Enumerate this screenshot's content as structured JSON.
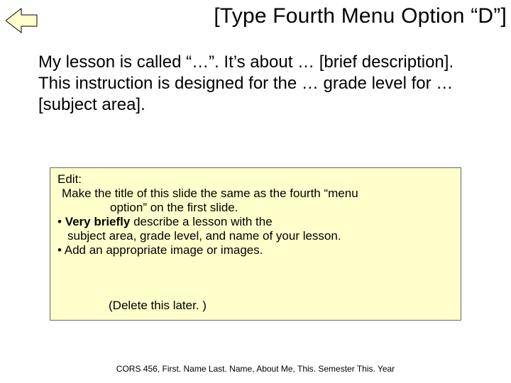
{
  "title": "[Type Fourth Menu Option “D”]",
  "body": "My lesson is called “…”. It’s about … [brief description]. This instruction is designed for the … grade level for …[subject area].",
  "note": {
    "edit_label": "Edit:",
    "line1a": " Make the title of this slide the same as the fourth “menu",
    "line1b": "option” on the first slide.",
    "bullet2_pre": "• ",
    "bullet2_bold": "Very briefly",
    "bullet2_post": " describe a lesson with the",
    "bullet2_cont": "subject area, grade level, and name of your lesson.",
    "bullet3": "• Add an appropriate image or images.",
    "delete": "(Delete this later. )"
  },
  "footer": "CORS 456, First. Name Last. Name, About Me, This. Semester This. Year",
  "icons": {
    "back": "back-arrow-icon"
  }
}
